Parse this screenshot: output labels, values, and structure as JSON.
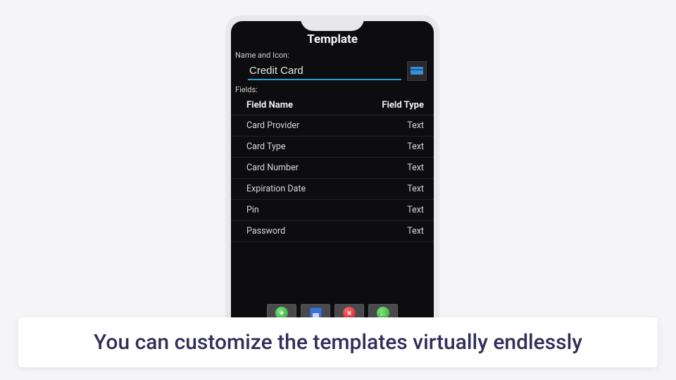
{
  "app": {
    "title": "Template",
    "name_label": "Name and Icon:",
    "name_value": "Credit Card",
    "fields_label": "Fields:",
    "table": {
      "col_name": "Field Name",
      "col_type": "Field Type"
    },
    "fields": [
      {
        "name": "Card Provider",
        "type": "Text"
      },
      {
        "name": "Card Type",
        "type": "Text"
      },
      {
        "name": "Card Number",
        "type": "Text"
      },
      {
        "name": "Expiration Date",
        "type": "Text"
      },
      {
        "name": "Pin",
        "type": "Text"
      },
      {
        "name": "Password",
        "type": "Text"
      }
    ],
    "buttons": {
      "add": "Add Field",
      "save": "Save",
      "delete": "Delete",
      "back": "Back"
    },
    "icon_name": "credit-card-icon"
  },
  "caption": "You can customize the templates virtually endlessly",
  "colors": {
    "accent": "#2a9fd6",
    "caption_text": "#312e5a"
  }
}
